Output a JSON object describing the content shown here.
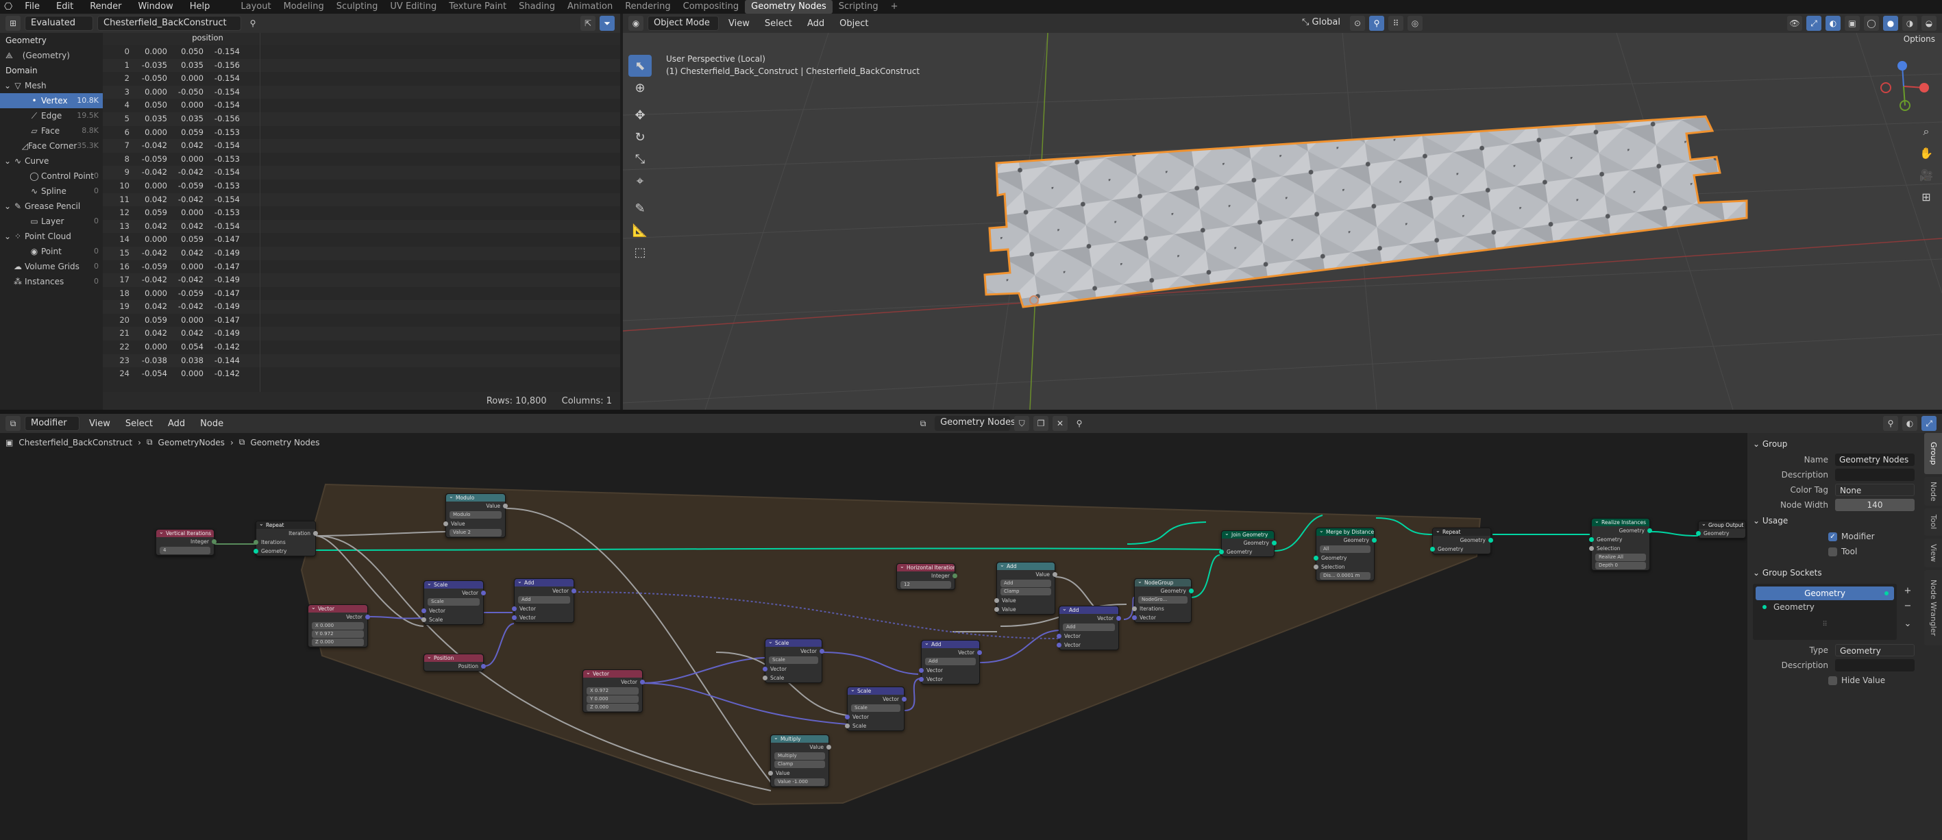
{
  "topbar": {
    "menus": [
      "File",
      "Edit",
      "Render",
      "Window",
      "Help"
    ],
    "workspaces": [
      "Layout",
      "Modeling",
      "Sculpting",
      "UV Editing",
      "Texture Paint",
      "Shading",
      "Animation",
      "Rendering",
      "Compositing",
      "Geometry Nodes",
      "Scripting",
      "+"
    ],
    "active_workspace": "Geometry Nodes"
  },
  "spreadsheet": {
    "mode": "Evaluated",
    "object": "Chesterfield_BackConstruct",
    "geometry_label": "Geometry",
    "geometry_item": "(Geometry)",
    "domain_label": "Domain",
    "tree": [
      {
        "label": "Mesh",
        "count": "",
        "level": 0,
        "sel": false
      },
      {
        "label": "Vertex",
        "count": "10.8K",
        "level": 1,
        "sel": true
      },
      {
        "label": "Edge",
        "count": "19.5K",
        "level": 1,
        "sel": false
      },
      {
        "label": "Face",
        "count": "8.8K",
        "level": 1,
        "sel": false
      },
      {
        "label": "Face Corner",
        "count": "35.3K",
        "level": 1,
        "sel": false
      },
      {
        "label": "Curve",
        "count": "",
        "level": 0,
        "sel": false
      },
      {
        "label": "Control Point",
        "count": "0",
        "level": 1,
        "sel": false
      },
      {
        "label": "Spline",
        "count": "0",
        "level": 1,
        "sel": false
      },
      {
        "label": "Grease Pencil",
        "count": "",
        "level": 0,
        "sel": false
      },
      {
        "label": "Layer",
        "count": "0",
        "level": 1,
        "sel": false
      },
      {
        "label": "Point Cloud",
        "count": "",
        "level": 0,
        "sel": false
      },
      {
        "label": "Point",
        "count": "0",
        "level": 1,
        "sel": false
      },
      {
        "label": "Volume Grids",
        "count": "0",
        "level": 0,
        "sel": false
      },
      {
        "label": "Instances",
        "count": "0",
        "level": 0,
        "sel": false
      }
    ],
    "column": "position",
    "rows": [
      [
        "0",
        "0.000",
        "0.050",
        "-0.154"
      ],
      [
        "1",
        "-0.035",
        "0.035",
        "-0.156"
      ],
      [
        "2",
        "-0.050",
        "0.000",
        "-0.154"
      ],
      [
        "3",
        "0.000",
        "-0.050",
        "-0.154"
      ],
      [
        "4",
        "0.050",
        "0.000",
        "-0.154"
      ],
      [
        "5",
        "0.035",
        "0.035",
        "-0.156"
      ],
      [
        "6",
        "0.000",
        "0.059",
        "-0.153"
      ],
      [
        "7",
        "-0.042",
        "0.042",
        "-0.154"
      ],
      [
        "8",
        "-0.059",
        "0.000",
        "-0.153"
      ],
      [
        "9",
        "-0.042",
        "-0.042",
        "-0.154"
      ],
      [
        "10",
        "0.000",
        "-0.059",
        "-0.153"
      ],
      [
        "11",
        "0.042",
        "-0.042",
        "-0.154"
      ],
      [
        "12",
        "0.059",
        "0.000",
        "-0.153"
      ],
      [
        "13",
        "0.042",
        "0.042",
        "-0.154"
      ],
      [
        "14",
        "0.000",
        "0.059",
        "-0.147"
      ],
      [
        "15",
        "-0.042",
        "0.042",
        "-0.149"
      ],
      [
        "16",
        "-0.059",
        "0.000",
        "-0.147"
      ],
      [
        "17",
        "-0.042",
        "-0.042",
        "-0.149"
      ],
      [
        "18",
        "0.000",
        "-0.059",
        "-0.147"
      ],
      [
        "19",
        "0.042",
        "-0.042",
        "-0.149"
      ],
      [
        "20",
        "0.059",
        "0.000",
        "-0.147"
      ],
      [
        "21",
        "0.042",
        "0.042",
        "-0.149"
      ],
      [
        "22",
        "0.000",
        "0.054",
        "-0.142"
      ],
      [
        "23",
        "-0.038",
        "0.038",
        "-0.144"
      ],
      [
        "24",
        "-0.054",
        "0.000",
        "-0.142"
      ]
    ],
    "rows_label": "Rows: 10,800",
    "cols_label": "Columns: 1"
  },
  "viewport": {
    "mode": "Object Mode",
    "menus": [
      "View",
      "Select",
      "Add",
      "Object"
    ],
    "orientation": "Global",
    "info_line1": "User Perspective (Local)",
    "info_line2": "(1) Chesterfield_Back_Construct | Chesterfield_BackConstruct",
    "options": "Options",
    "accent": "#f0922f"
  },
  "nodeeditor": {
    "type": "Modifier",
    "menus": [
      "View",
      "Select",
      "Add",
      "Node"
    ],
    "tree_name": "Geometry Nodes",
    "breadcrumb": [
      "Chesterfield_BackConstruct",
      "GeometryNodes",
      "Geometry Nodes"
    ],
    "nodes": {
      "vert_iter": {
        "title": "Vertical Iterations",
        "out": "Integer",
        "val": "4"
      },
      "repeat_in": {
        "title": "Repeat",
        "out": "Iteration",
        "in1": "Iterations",
        "in2": "Geometry"
      },
      "modulo": {
        "title": "Modulo",
        "out": "Value",
        "mode": "Modulo",
        "in": "Value",
        "val": "Value    2"
      },
      "vector1": {
        "title": "Vector",
        "out": "Vector",
        "x": "X    0.000",
        "y": "Y    0.972",
        "z": "Z    0.000"
      },
      "scale1": {
        "title": "Scale",
        "out": "Vector",
        "mode": "Scale",
        "in1": "Vector",
        "in2": "Scale"
      },
      "add1": {
        "title": "Add",
        "out": "Vector",
        "mode": "Add",
        "in1": "Vector",
        "in2": "Vector"
      },
      "position": {
        "title": "Position",
        "out": "Position"
      },
      "vector2": {
        "title": "Vector",
        "out": "Vector",
        "x": "X    0.972",
        "y": "Y    0.000",
        "z": "Z    0.000"
      },
      "scale2": {
        "title": "Scale",
        "out": "Vector",
        "mode": "Scale",
        "in1": "Vector",
        "in2": "Scale"
      },
      "multiply": {
        "title": "Multiply",
        "out": "Value",
        "mode": "Multiply",
        "clamp": "Clamp",
        "in": "Value",
        "val": "Value   -1.000"
      },
      "scale3": {
        "title": "Scale",
        "out": "Vector",
        "mode": "Scale",
        "in1": "Vector",
        "in2": "Scale"
      },
      "add2": {
        "title": "Add",
        "out": "Vector",
        "mode": "Add",
        "in1": "Vector",
        "in2": "Vector"
      },
      "horiz_iter": {
        "title": "Horizontal Iterations",
        "out": "Integer",
        "val": "12"
      },
      "add3": {
        "title": "Add",
        "out": "Value",
        "mode": "Add",
        "clamp": "Clamp",
        "in1": "Value",
        "in2": "Value"
      },
      "add4": {
        "title": "Add",
        "out": "Vector",
        "mode": "Add",
        "in1": "Vector",
        "in2": "Vector"
      },
      "nodegroup": {
        "title": "NodeGroup",
        "out": "Geometry",
        "sel": "NodeGro...",
        "in1": "Iterations",
        "in2": "Vector"
      },
      "join": {
        "title": "Join Geometry",
        "out": "Geometry",
        "in": "Geometry"
      },
      "merge": {
        "title": "Merge by Distance",
        "out": "Geometry",
        "mode": "All",
        "in1": "Geometry",
        "in2": "Selection",
        "val": "Dis...   0.0001 m"
      },
      "repeat_out": {
        "title": "Repeat",
        "out": "Geometry",
        "in": "Geometry"
      },
      "realize": {
        "title": "Realize Instances",
        "out": "Geometry",
        "in1": "Geometry",
        "in2": "Selection",
        "chk": "Realize All",
        "val": "Depth      0"
      },
      "group_out": {
        "title": "Group Output",
        "in": "Geometry"
      }
    }
  },
  "npanel": {
    "group_header": "Group",
    "name_label": "Name",
    "name_val": "Geometry Nodes",
    "desc_label": "Description",
    "color_label": "Color Tag",
    "color_val": "None",
    "width_label": "Node Width",
    "width_val": "140",
    "usage_header": "Usage",
    "modifier": "Modifier",
    "tool": "Tool",
    "sockets_header": "Group Sockets",
    "sockets": [
      "Geometry",
      "Geometry"
    ],
    "type_label": "Type",
    "type_val": "Geometry",
    "desc2_label": "Description",
    "hide": "Hide Value",
    "tabs": [
      "Group",
      "Node",
      "Tool",
      "View",
      "Node Wrangler"
    ]
  }
}
